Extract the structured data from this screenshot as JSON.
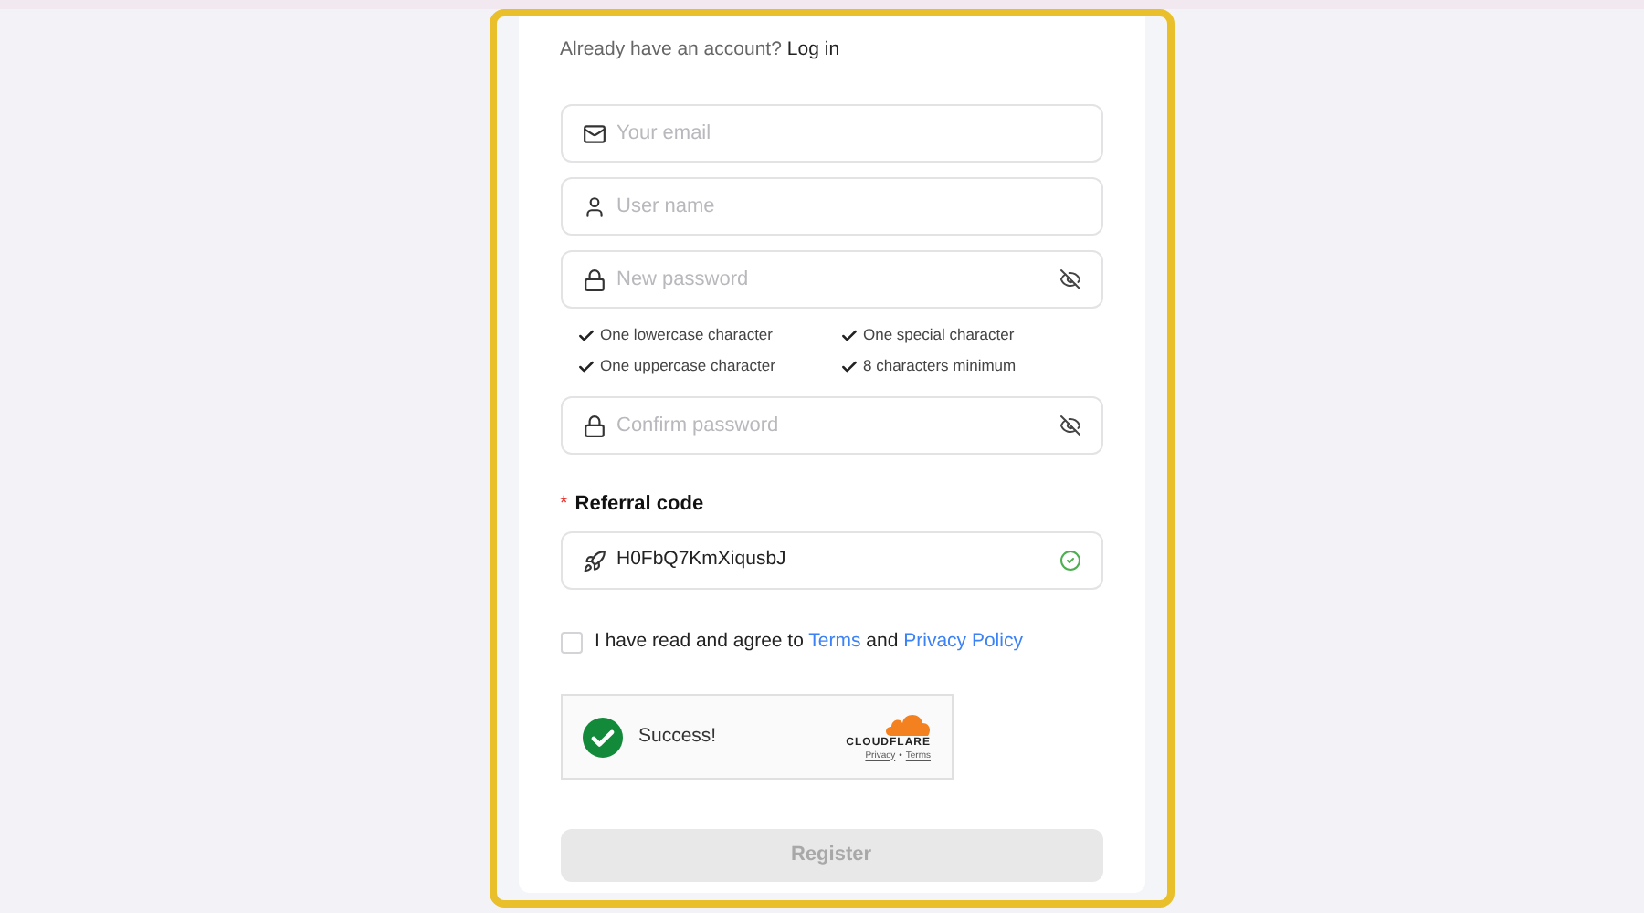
{
  "login_prompt": {
    "text": "Already have an account?",
    "link": "Log in"
  },
  "fields": [
    {
      "kind": "email",
      "placeholder": "Your email"
    },
    {
      "kind": "user",
      "placeholder": "User name"
    },
    {
      "kind": "password",
      "placeholder": "New password"
    }
  ],
  "requirements": [
    {
      "label": "One lowercase character",
      "met": true
    },
    {
      "label": "One special character",
      "met": true
    },
    {
      "label": "One uppercase character",
      "met": true
    },
    {
      "label": "8 characters minimum",
      "met": true
    }
  ],
  "confirm_field": {
    "kind": "password",
    "placeholder": "Confirm password"
  },
  "referral": {
    "label": "Referral code",
    "required_mark": "*",
    "value": "H0FbQ7KmXiqusbJ",
    "valid": true
  },
  "agreement": {
    "checked": false,
    "text": "I have read and agree to",
    "terms": "Terms",
    "and": "and",
    "privacy": "Privacy Policy"
  },
  "captcha": {
    "status": "Success!",
    "brand": "CLOUDFLARE",
    "privacy": "Privacy",
    "separator": "•",
    "terms": "Terms"
  },
  "register": {
    "label": "Register",
    "disabled": true
  }
}
